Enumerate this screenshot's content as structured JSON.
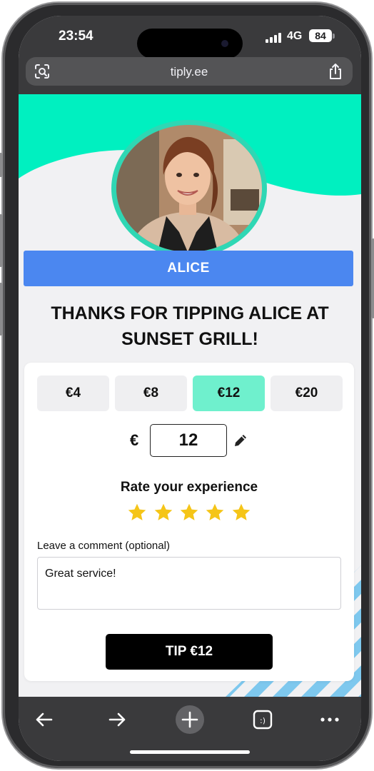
{
  "status_bar": {
    "time": "23:54",
    "network": "4G",
    "battery": "84"
  },
  "browser": {
    "url": "tiply.ee"
  },
  "profile": {
    "name": "ALICE"
  },
  "headline": "THANKS FOR TIPPING ALICE AT SUNSET GRILL!",
  "tip_options": [
    {
      "label": "€4",
      "selected": false
    },
    {
      "label": "€8",
      "selected": false
    },
    {
      "label": "€12",
      "selected": true
    },
    {
      "label": "€20",
      "selected": false
    }
  ],
  "custom_amount": {
    "currency": "€",
    "value": "12"
  },
  "rating": {
    "label": "Rate your experience",
    "stars": 5,
    "max": 5
  },
  "comment": {
    "label": "Leave a comment (optional)",
    "value": "Great service!"
  },
  "submit": {
    "label": "TIP €12"
  },
  "colors": {
    "accent": "#00f0c0",
    "name_bar": "#4b87f0",
    "selected_amount": "#6ff0cd",
    "star": "#f5c518",
    "stripe": "#7ec8ee"
  },
  "icons": {
    "url_left": "page-scan-icon",
    "url_right": "share-icon",
    "edit": "pencil-icon",
    "nav": [
      "back-arrow-icon",
      "forward-arrow-icon",
      "plus-icon",
      "tabs-icon",
      "more-icon"
    ]
  }
}
